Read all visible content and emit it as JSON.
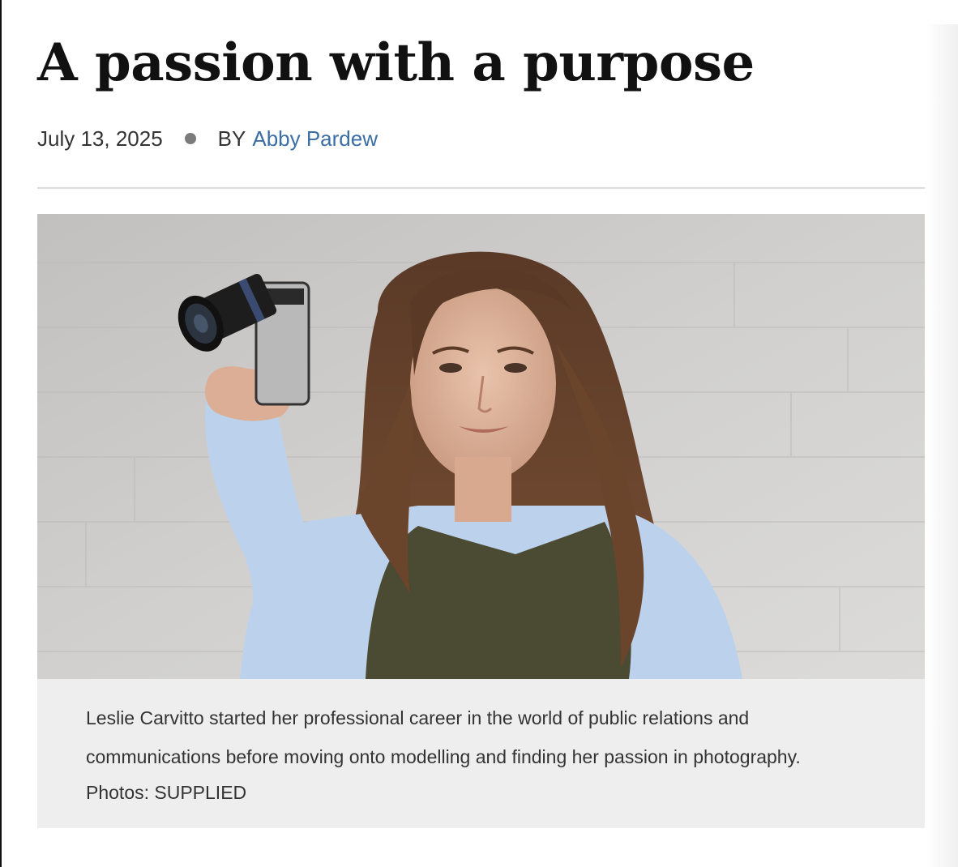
{
  "article": {
    "title": "A passion with a purpose",
    "date": "July 13, 2025",
    "by_label": "BY",
    "author": "Abby Pardew"
  },
  "figure": {
    "caption": "Leslie Carvitto started her professional career in the world of public relations and communications before moving onto modelling and finding her passion in photography.",
    "credit": "Photos: SUPPLIED"
  },
  "colors": {
    "author_link": "#3a6ea5",
    "caption_background": "#eeeeee",
    "divider": "#dddddd"
  }
}
